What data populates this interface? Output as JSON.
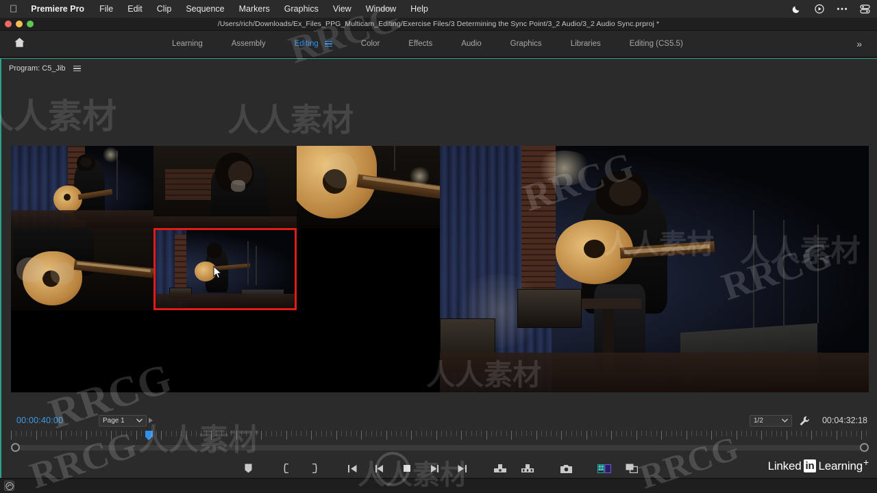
{
  "macos_menu": {
    "apple_icon": "apple-logo",
    "app_name": "Premiere Pro",
    "items": [
      "File",
      "Edit",
      "Clip",
      "Sequence",
      "Markers",
      "Graphics",
      "View",
      "Window",
      "Help"
    ],
    "status_icons": [
      "moon-icon",
      "play-circle-icon",
      "ellipsis-icon",
      "control-center-icon"
    ]
  },
  "titlebar": {
    "path": "/Users/rich/Downloads/Ex_Files_PPG_Multicam_Editing/Exercise Files/3 Determining the Sync Point/3_2 Audio/3_2 Audio Sync.prproj *",
    "traffic_lights": [
      "close",
      "minimize",
      "zoom"
    ]
  },
  "workspace_bar": {
    "home_icon": "home-icon",
    "tabs": [
      {
        "label": "Learning",
        "active": false
      },
      {
        "label": "Assembly",
        "active": false
      },
      {
        "label": "Editing",
        "active": true
      },
      {
        "label": "Color",
        "active": false
      },
      {
        "label": "Effects",
        "active": false
      },
      {
        "label": "Audio",
        "active": false
      },
      {
        "label": "Graphics",
        "active": false
      },
      {
        "label": "Libraries",
        "active": false
      },
      {
        "label": "Editing (CS5.5)",
        "active": false
      }
    ],
    "overflow_label": "»",
    "active_accent": "#2f8fea"
  },
  "program_panel": {
    "title": "Program: C5_Jib",
    "menu_icon": "panel-menu-icon",
    "accent": "#2fa08c"
  },
  "multicam": {
    "selected_camera": 5,
    "selection_color": "#e01b18",
    "cameras": [
      {
        "index": 1,
        "name": "cam-1-wide-left"
      },
      {
        "index": 2,
        "name": "cam-2-medium-face"
      },
      {
        "index": 3,
        "name": "cam-3-guitar-closeup"
      },
      {
        "index": 4,
        "name": "cam-4-hands-closeup"
      },
      {
        "index": 5,
        "name": "cam-5-jib-wide"
      }
    ]
  },
  "playback": {
    "current_timecode": "00:00:40:00",
    "duration_timecode": "00:04:32:18",
    "page_selector": "Page 1",
    "page_chevron": "chevron-down-icon",
    "next_page_icon": "play-triangle-icon",
    "zoom_level": "1/2",
    "zoom_chevron": "chevron-down-icon",
    "settings_icon": "wrench-icon",
    "timecode_color": "#3d9ae8"
  },
  "transport_buttons": [
    {
      "name": "add-marker-button",
      "icon": "marker-icon"
    },
    {
      "name": "mark-in-button",
      "icon": "mark-in-icon"
    },
    {
      "name": "mark-out-button",
      "icon": "mark-out-icon"
    },
    {
      "name": "go-to-in-button",
      "icon": "go-to-in-icon"
    },
    {
      "name": "step-back-button",
      "icon": "step-back-icon"
    },
    {
      "name": "play-stop-button",
      "icon": "play-icon"
    },
    {
      "name": "step-forward-button",
      "icon": "step-forward-icon"
    },
    {
      "name": "go-to-out-button",
      "icon": "go-to-out-icon"
    },
    {
      "name": "lift-button",
      "icon": "lift-icon"
    },
    {
      "name": "extract-button",
      "icon": "extract-icon"
    },
    {
      "name": "export-frame-button",
      "icon": "camera-icon"
    },
    {
      "name": "multicam-toggle-button",
      "icon": "multicam-icon"
    },
    {
      "name": "comparison-view-button",
      "icon": "comparison-view-icon"
    }
  ],
  "branding": {
    "linkedin_word": "Linked",
    "linkedin_in": "in",
    "learning_word": "Learning",
    "plus": "+"
  },
  "status_strip": {
    "creative_cloud_icon": "creative-cloud-icon"
  },
  "watermarks": {
    "latin": "RRCG",
    "chinese": "人人素材"
  }
}
